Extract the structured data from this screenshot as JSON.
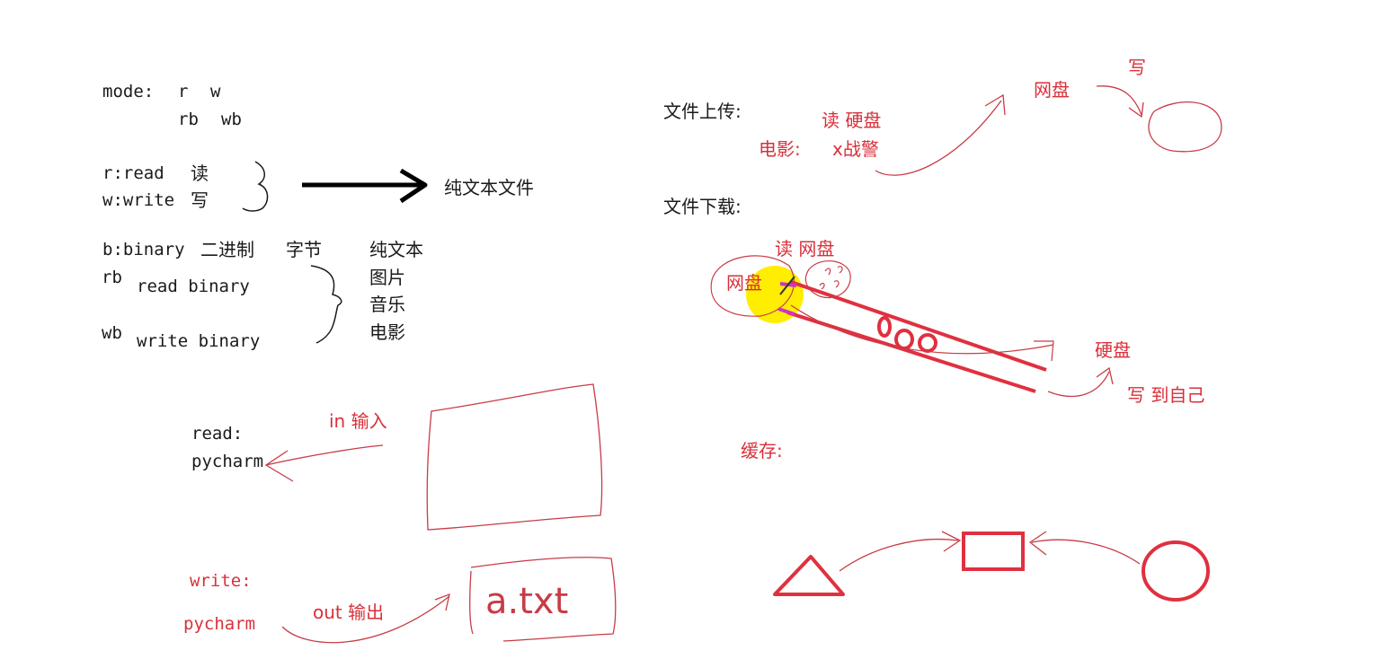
{
  "colors": {
    "ink": "#1a1a1a",
    "annotation": "#d9303a",
    "highlight": "#ffee00",
    "magenta": "#cc33cc"
  },
  "left": {
    "mode_label": "mode:",
    "mode_r": "r",
    "mode_w": "w",
    "mode_rb": "rb",
    "mode_wb": "wb",
    "r_read": "r:read",
    "read_cn": "读",
    "w_write": "w:write",
    "write_cn": "写",
    "plain_text_file": "纯文本文件",
    "b_binary": "b:binary",
    "binary_cn": "二进制",
    "bytes_cn": "字节",
    "rb": "rb",
    "read_binary": "read binary",
    "wb": "wb",
    "write_binary": "write binary",
    "types": [
      "纯文本",
      "图片",
      "音乐",
      "电影"
    ],
    "read_label": "read:",
    "pycharm_1": "pycharm",
    "in_input": "in 输入",
    "write_label": "write:",
    "pycharm_2": "pycharm",
    "out_output": "out 输出",
    "file_name": "a.txt"
  },
  "right": {
    "upload": "文件上传:",
    "read_disk": "读 硬盘",
    "movie": "电影:",
    "movie_title": "x战警",
    "netdisk_top": "网盘",
    "write_top": "写",
    "download": "文件下载:",
    "read_netdisk": "读 网盘",
    "netdisk_left": "网盘",
    "disk_right": "硬盘",
    "write_self": "写 到自己",
    "cache": "缓存:"
  }
}
